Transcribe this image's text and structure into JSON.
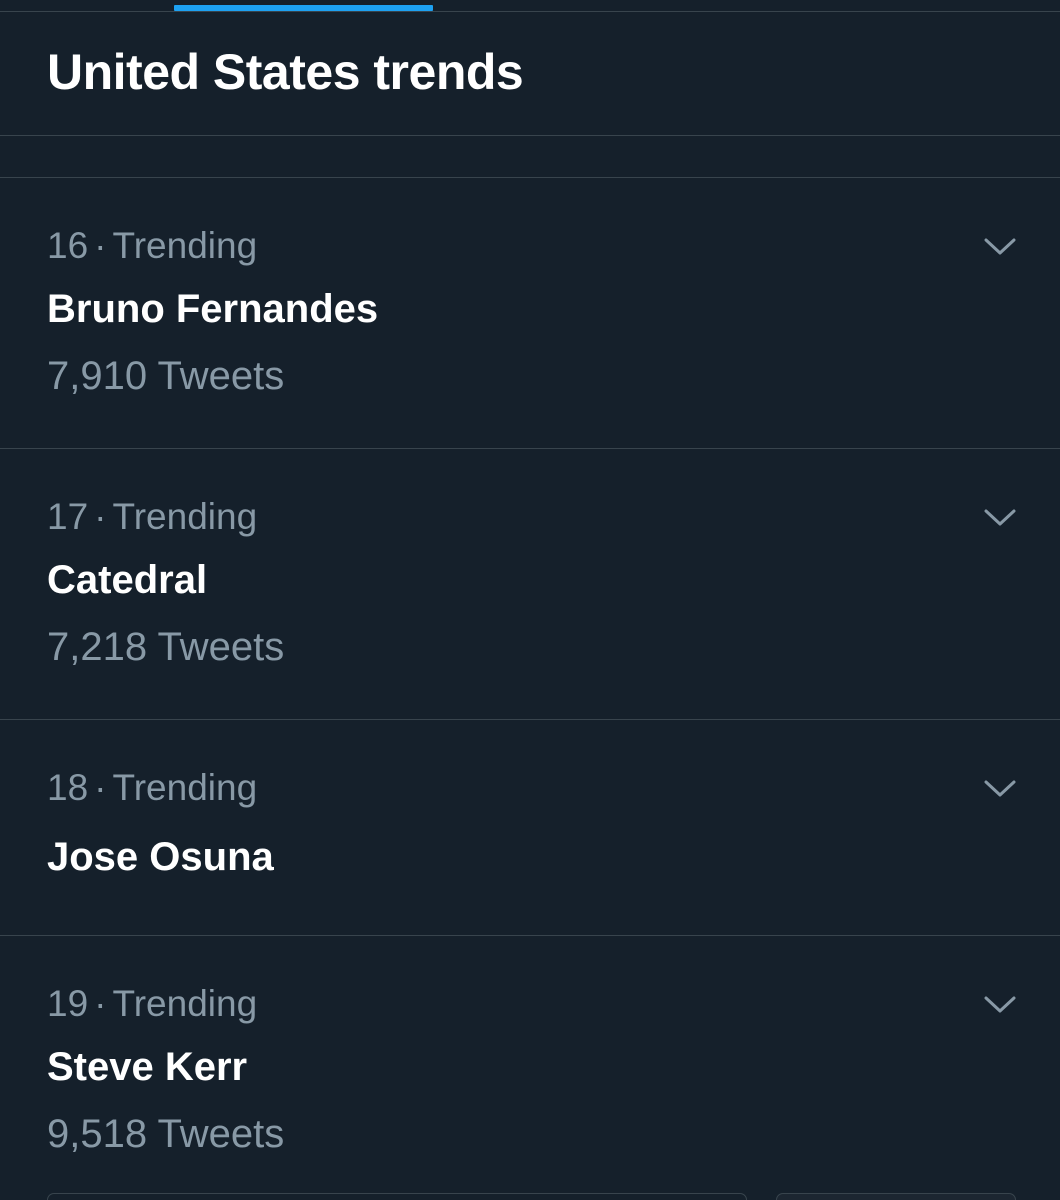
{
  "header": {
    "title": "United States trends"
  },
  "colors": {
    "background": "#15202b",
    "accent": "#1da1f2",
    "secondary_text": "#8899a6",
    "divider": "#38444d"
  },
  "trends": [
    {
      "rank": "16",
      "separator": "·",
      "category": "Trending",
      "name": "Bruno Fernandes",
      "count": "7,910 Tweets",
      "menu_icon": "chevron-down-icon"
    },
    {
      "rank": "17",
      "separator": "·",
      "category": "Trending",
      "name": "Catedral",
      "count": "7,218 Tweets",
      "menu_icon": "chevron-down-icon"
    },
    {
      "rank": "18",
      "separator": "·",
      "category": "Trending",
      "name": "Jose Osuna",
      "menu_icon": "chevron-down-icon"
    },
    {
      "rank": "19",
      "separator": "·",
      "category": "Trending",
      "name": "Steve Kerr",
      "count": "9,518 Tweets",
      "menu_icon": "chevron-down-icon"
    }
  ]
}
